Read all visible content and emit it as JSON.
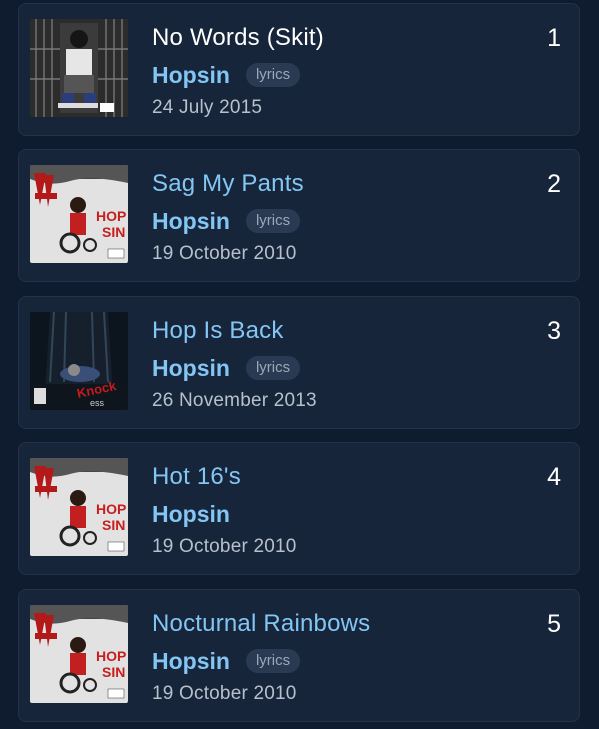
{
  "tracks": [
    {
      "rank": "1",
      "title": "No Words (Skit)",
      "artist": "Hopsin",
      "badge": "lyrics",
      "date": "24 July 2015",
      "art": "knock-madness-cover"
    },
    {
      "rank": "2",
      "title": "Sag My Pants",
      "artist": "Hopsin",
      "badge": "lyrics",
      "date": "19 October 2010",
      "art": "raw-cover"
    },
    {
      "rank": "3",
      "title": "Hop Is Back",
      "artist": "Hopsin",
      "badge": "lyrics",
      "date": "26 November 2013",
      "art": "knock-madness-night-cover"
    },
    {
      "rank": "4",
      "title": "Hot 16's",
      "artist": "Hopsin",
      "badge": "",
      "date": "19 October 2010",
      "art": "raw-cover"
    },
    {
      "rank": "5",
      "title": "Nocturnal Rainbows",
      "artist": "Hopsin",
      "badge": "lyrics",
      "date": "19 October 2010",
      "art": "raw-cover"
    }
  ],
  "colors": {
    "background": "#0f1b2e",
    "card": "#17253a",
    "accent": "#83c6f4",
    "badge_bg": "#293a52"
  }
}
